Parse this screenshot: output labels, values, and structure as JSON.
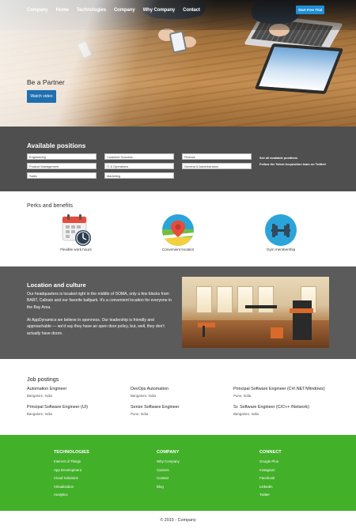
{
  "nav": {
    "links": [
      "Company",
      "Home",
      "Technologies",
      "Company",
      "Why Company",
      "Contact"
    ],
    "trial_button": "Start Free Trial"
  },
  "hero": {
    "title": "Be a Partner",
    "button": "Watch video"
  },
  "positions": {
    "title": "Available positions",
    "boxes": [
      "Engineering",
      "Customer Success",
      "Finance",
      "Product Management",
      "IT & Operations",
      "General & Administration",
      "Sales",
      "Marketing"
    ],
    "links": [
      "See all available positions",
      "Follow the Talent Acquisition team on Twitter!"
    ]
  },
  "perks": {
    "title": "Perks and benefits",
    "items": [
      {
        "label": "Flexible work hours",
        "icon": "calendar-clock-icon"
      },
      {
        "label": "Convenient location",
        "icon": "location-pin-icon"
      },
      {
        "label": "Gym membership",
        "icon": "dumbbell-icon"
      }
    ]
  },
  "location": {
    "title": "Location and culture",
    "para1": "Our headquarters is located right in the middle of SOMA, only a few blocks from BART, Caltrain and our favorite ballpark. It's a convenient location for everyone in the Bay Area.",
    "para2": "At AppDynamics we believe in openness. Our leadership is friendly and approachable — we'd say they have an open door policy, but, well, they don't actually have doors."
  },
  "jobs": {
    "title": "Job postings",
    "items": [
      {
        "title": "Automation Engineer",
        "location": "Bangalore, India"
      },
      {
        "title": "DevOps Automation",
        "location": "Bangalore, India"
      },
      {
        "title": "Principal Software Engineer (C#/.NET/Windows)",
        "location": "Pune, India"
      },
      {
        "title": "Principal Software Engineer (UI)",
        "location": "Bangalore, India"
      },
      {
        "title": "Senior Software Engineer",
        "location": "Pune, India"
      },
      {
        "title": "Sr. Software Engineer (C/C++ /Network)",
        "location": "Bangalore, India"
      }
    ]
  },
  "footer": {
    "columns": [
      {
        "title": "TECHNOLOGIES",
        "items": [
          "Internet of Things",
          "App Development",
          "Cloud Solutions",
          "Virtualization",
          "Analytics"
        ]
      },
      {
        "title": "COMPANY",
        "items": [
          "Why Company",
          "Careers",
          "Contact",
          "Blog"
        ]
      },
      {
        "title": "CONNECT",
        "items": [
          "Google Plus",
          "Instagram",
          "Facebook",
          "LinkedIn",
          "Twitter"
        ]
      }
    ],
    "copyright": "© 2015 - Company"
  },
  "colors": {
    "accent_blue": "#1e8fd8",
    "footer_green": "#43b02a",
    "dark_section": "#4f4f4f"
  }
}
